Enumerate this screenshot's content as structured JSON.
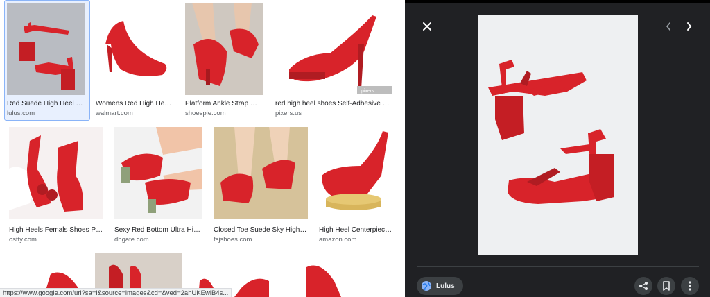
{
  "results": [
    {
      "title": "Red Suede High Heel S...",
      "domain": "lulus.com"
    },
    {
      "title": "Womens Red High Heels...",
      "domain": "walmart.com"
    },
    {
      "title": "Platform Ankle Strap Hi...",
      "domain": "shoespie.com"
    },
    {
      "title": "red high heel shoes Self-Adhesive Wal...",
      "domain": "pixers.us"
    },
    {
      "title": "High Heels Femals Shoes Pu...",
      "domain": "ostty.com"
    },
    {
      "title": "Sexy Red Bottom Ultra High...",
      "domain": "dhgate.com"
    },
    {
      "title": "Closed Toe Suede Sky High H...",
      "domain": "fsjshoes.com"
    },
    {
      "title": "High Heel Centerpiece ...",
      "domain": "amazon.com"
    }
  ],
  "watermark": "pixers",
  "status_url": "https://www.google.com/url?sa=i&source=images&cd=&ved=2ahUKEwiB4s...",
  "viewer": {
    "source_label": "Lulus",
    "icons": {
      "close": "close-icon",
      "prev": "chevron-left-icon",
      "next": "chevron-right-icon",
      "globe": "globe-icon",
      "share": "share-icon",
      "save": "bookmark-icon",
      "more": "more-vertical-icon"
    }
  },
  "colors": {
    "shoe_red": "#d8232a",
    "viewer_bg": "#202124",
    "selection": "#8ab4f8"
  }
}
